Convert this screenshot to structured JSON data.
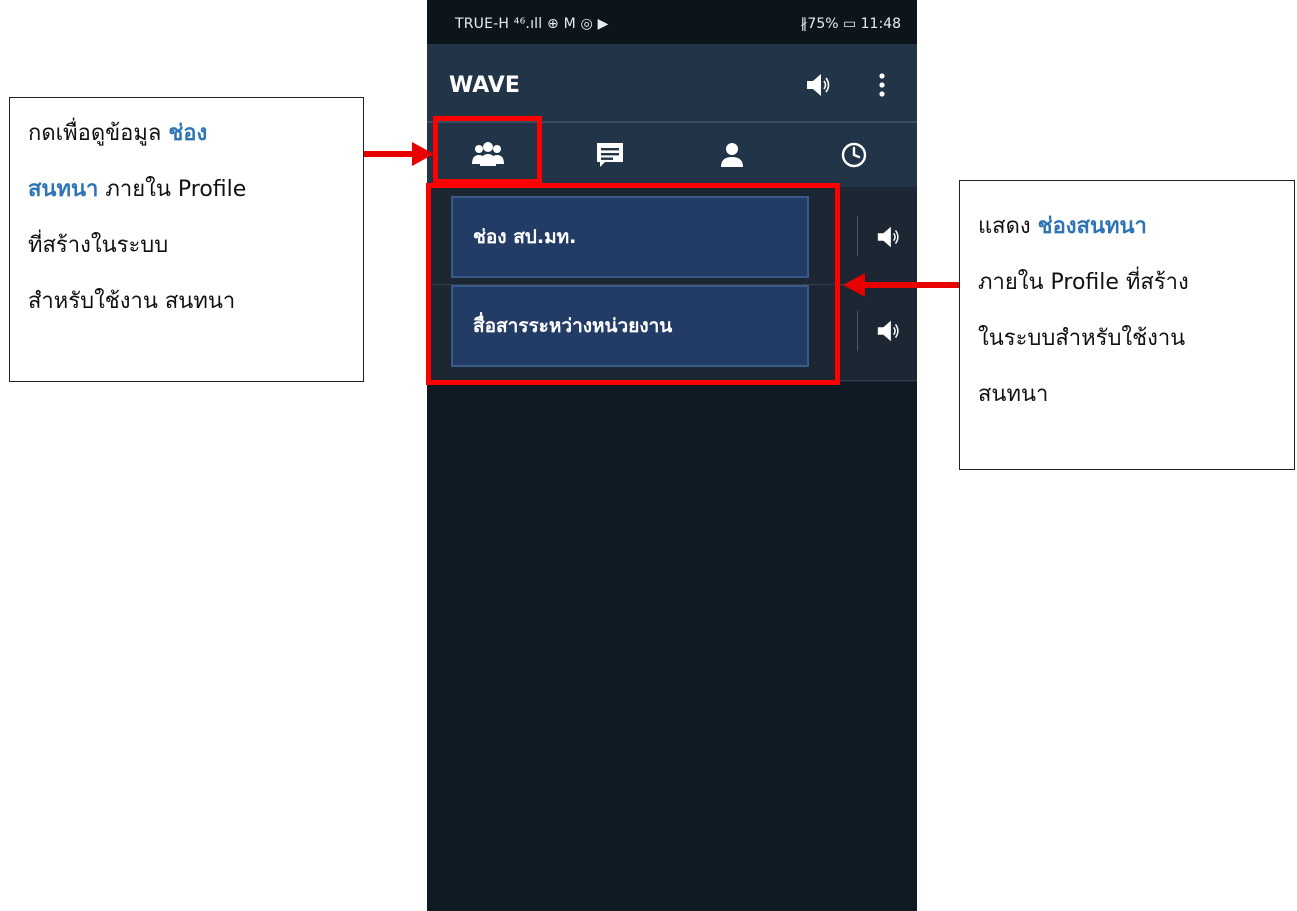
{
  "status_bar": {
    "left": "TRUE-H ⁴⁶.ıll ⊕ M ◎ ▶",
    "right": "∦75% ▭ 11:48"
  },
  "app_bar": {
    "title": "WAVE",
    "speaker_icon": "speaker-icon",
    "more_icon": "more-vertical-icon"
  },
  "tabs": [
    {
      "icon": "group-icon",
      "selected": true
    },
    {
      "icon": "chat-icon",
      "selected": false
    },
    {
      "icon": "person-icon",
      "selected": false
    },
    {
      "icon": "clock-icon",
      "selected": false
    }
  ],
  "channels": [
    {
      "name": "ช่อง สป.มท."
    },
    {
      "name": "สื่อสารระหว่างหน่วยงาน"
    }
  ],
  "annotation_left": {
    "line1_prefix": "กดเพื่อดูข้อมูล ",
    "line1_highlight": "ช่อง",
    "line2_highlight": "สนทนา",
    "line2_suffix": " ภายใน Profile",
    "line3": "ที่สร้างในระบบ",
    "line4": "สำหรับใช้งาน สนทนา"
  },
  "annotation_right": {
    "line1_prefix": "แสดง ",
    "line1_highlight": "ช่องสนทนา",
    "line2": "ภายใน Profile ที่สร้าง",
    "line3": "ในระบบสำหรับใช้งาน",
    "line4": "สนทนา"
  },
  "colors": {
    "highlight_text": "#2f75b5",
    "annotation_red": "#ff0000",
    "app_bar": "#223447",
    "channel_button": "#223c66"
  }
}
